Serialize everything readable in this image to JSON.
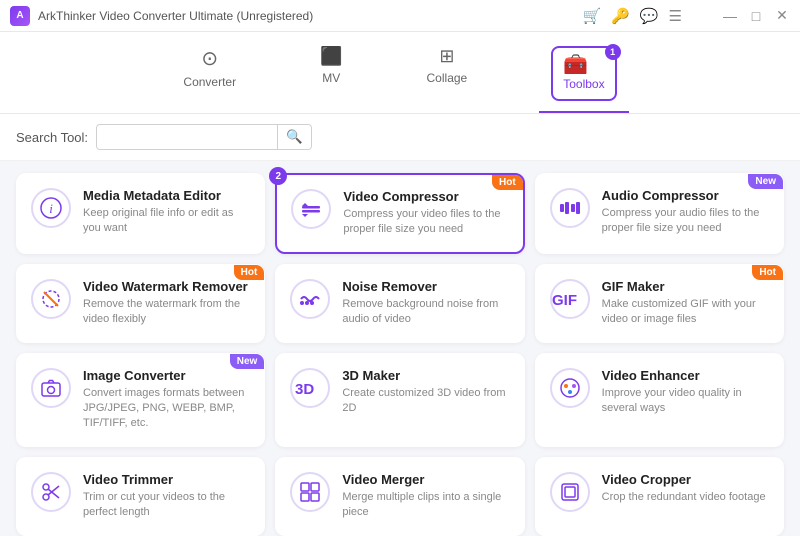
{
  "app": {
    "title": "ArkThinker Video Converter Ultimate (Unregistered)"
  },
  "nav": {
    "tabs": [
      {
        "id": "converter",
        "label": "Converter",
        "icon": "⊙",
        "active": false
      },
      {
        "id": "mv",
        "label": "MV",
        "icon": "🖼",
        "active": false
      },
      {
        "id": "collage",
        "label": "Collage",
        "icon": "⊞",
        "active": false
      },
      {
        "id": "toolbox",
        "label": "Toolbox",
        "icon": "🧰",
        "active": true,
        "badge": "1"
      }
    ]
  },
  "search": {
    "label": "Search Tool:",
    "placeholder": "",
    "icon": "🔍"
  },
  "tools": [
    {
      "id": "media-metadata",
      "title": "Media Metadata Editor",
      "desc": "Keep original file info or edit as you want",
      "icon": "ℹ",
      "badge": null,
      "selected": false
    },
    {
      "id": "video-compressor",
      "title": "Video Compressor",
      "desc": "Compress your video files to the proper file size you need",
      "icon": "⇔",
      "badge": "Hot",
      "badge_type": "hot",
      "selected": true,
      "circle_badge": "2"
    },
    {
      "id": "audio-compressor",
      "title": "Audio Compressor",
      "desc": "Compress your audio files to the proper file size you need",
      "icon": "◁▷",
      "badge": "New",
      "badge_type": "new",
      "selected": false
    },
    {
      "id": "video-watermark",
      "title": "Video Watermark Remover",
      "desc": "Remove the watermark from the video flexibly",
      "icon": "✦",
      "badge": "Hot",
      "badge_type": "hot",
      "selected": false
    },
    {
      "id": "noise-remover",
      "title": "Noise Remover",
      "desc": "Remove background noise from audio of video",
      "icon": "〜",
      "badge": null,
      "selected": false
    },
    {
      "id": "gif-maker",
      "title": "GIF Maker",
      "desc": "Make customized GIF with your video or image files",
      "icon": "GIF",
      "badge": "Hot",
      "badge_type": "hot",
      "selected": false
    },
    {
      "id": "image-converter",
      "title": "Image Converter",
      "desc": "Convert images formats between JPG/JPEG, PNG, WEBP, BMP, TIF/TIFF, etc.",
      "icon": "📷",
      "badge": "New",
      "badge_type": "new",
      "selected": false
    },
    {
      "id": "3d-maker",
      "title": "3D Maker",
      "desc": "Create customized 3D video from 2D",
      "icon": "3D",
      "badge": null,
      "selected": false
    },
    {
      "id": "video-enhancer",
      "title": "Video Enhancer",
      "desc": "Improve your video quality in several ways",
      "icon": "🎨",
      "badge": null,
      "selected": false
    },
    {
      "id": "video-trimmer",
      "title": "Video Trimmer",
      "desc": "Trim or cut your videos to the perfect length",
      "icon": "✂",
      "badge": null,
      "selected": false
    },
    {
      "id": "video-merger",
      "title": "Video Merger",
      "desc": "Merge multiple clips into a single piece",
      "icon": "⊞",
      "badge": null,
      "selected": false
    },
    {
      "id": "video-cropper",
      "title": "Video Cropper",
      "desc": "Crop the redundant video footage",
      "icon": "⊡",
      "badge": null,
      "selected": false
    }
  ],
  "titlebar_buttons": {
    "minimize": "—",
    "maximize": "□",
    "close": "✕"
  }
}
